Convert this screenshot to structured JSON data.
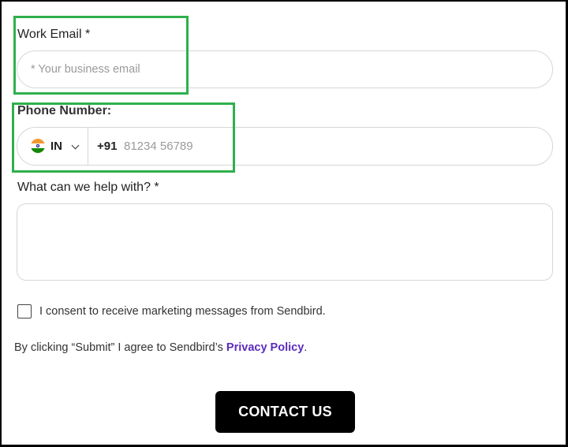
{
  "work_email": {
    "label": "Work Email *",
    "placeholder": "* Your business email"
  },
  "phone": {
    "label": "Phone Number:",
    "country_code": "IN",
    "dial_code": "+91",
    "placeholder": "81234 56789",
    "flag_colors": [
      "#f29933",
      "#ffffff",
      "#138808"
    ],
    "flag_wheel_color": "#000080"
  },
  "help": {
    "label": "What can we help with? *",
    "value": ""
  },
  "consent": {
    "label": "I consent to receive marketing messages from Sendbird.",
    "checked": false
  },
  "terms": {
    "prefix": "By clicking “Submit” I agree to Sendbird’s ",
    "link_text": "Privacy Policy",
    "suffix": "."
  },
  "submit": {
    "label": "CONTACT US"
  },
  "colors": {
    "highlight": "#2fb04c",
    "link": "#5b2bbf",
    "button_bg": "#000000"
  }
}
